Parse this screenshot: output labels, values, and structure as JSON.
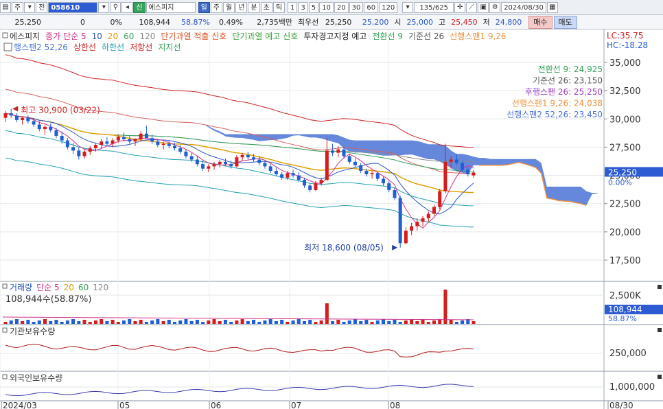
{
  "toolbar": {
    "code": "058610",
    "main_sub": "주",
    "all_label": "전",
    "credit_badge": "신",
    "stock_name": "에스피지",
    "periods": [
      "일",
      "주",
      "월",
      "년",
      "분",
      "초",
      "틱"
    ],
    "selected_period": "일",
    "intervals": [
      "1",
      "3",
      "5",
      "10",
      "20",
      "30",
      "60",
      "120"
    ],
    "count": "135/625",
    "date": "2024/08/30"
  },
  "quote": {
    "price": "25,250",
    "change": "0",
    "change_pct": "0%",
    "volume": "108,944",
    "vol_ratio": "58.87%",
    "turnover_pct": "0.49%",
    "amount": "2,735백만",
    "best_ask_label": "최우선",
    "best_ask": "25,250",
    "best_bid": "25,200",
    "open_label": "시",
    "open": "25,000",
    "high_label": "고",
    "high": "25,450",
    "low_label": "저",
    "low": "24,800",
    "buy_label": "매수",
    "sell_label": "매도"
  },
  "legend": {
    "line1": [
      {
        "text": "에스피지",
        "color": "#333333"
      },
      {
        "text": "종가 단순 5",
        "color": "#d0308a"
      },
      {
        "text": "10",
        "color": "#2a57c6"
      },
      {
        "text": "20",
        "color": "#e0a000"
      },
      {
        "text": "60",
        "color": "#35a35b"
      },
      {
        "text": "120",
        "color": "#8a8a8a"
      },
      {
        "text": "단기과열 적출 신호",
        "color": "#e05020"
      },
      {
        "text": "단기과열 예고 신호",
        "color": "#35a335"
      },
      {
        "text": "투자경고지정 예고",
        "color": "#222222"
      },
      {
        "text": "전환선 9",
        "color": "#35a35b"
      },
      {
        "text": "기준선 26",
        "color": "#555555"
      },
      {
        "text": "선행스팬1 9,26",
        "color": "#f09040"
      }
    ],
    "line2": [
      {
        "text": "행스팬2 52,26",
        "color": "#4b73d6"
      },
      {
        "text": "상한선",
        "color": "#d02020"
      },
      {
        "text": "하한선",
        "color": "#20a0b0"
      },
      {
        "text": "저항선",
        "color": "#d02020"
      },
      {
        "text": "지지선",
        "color": "#35a35b"
      }
    ],
    "lc": "LC:35.75",
    "hc": "HC:-18.28"
  },
  "ichimoku_labels": [
    {
      "text": "전환선 9: 24,925",
      "color": "#35a35b"
    },
    {
      "text": "기준선 26: 23,150",
      "color": "#555555"
    },
    {
      "text": "후행스팬 26: 25,250",
      "color": "#a040c0"
    },
    {
      "text": "선행스팬1 9,26: 24,038",
      "color": "#f09040"
    },
    {
      "text": "선행스팬2 52,26: 23,450",
      "color": "#4b73d6"
    }
  ],
  "annotations": {
    "high": "최고 30,900 (03/22)",
    "low": "최저 18,600 (08/05)"
  },
  "price_axis": [
    "35,000",
    "32,500",
    "30,000",
    "27,500",
    "25,000",
    "22,500",
    "20,000",
    "17,500"
  ],
  "price_tag": {
    "value": "25,250",
    "pct": "0.00%"
  },
  "volume_panel": {
    "legend": [
      {
        "text": "거래량",
        "color": "#2a57c6"
      },
      {
        "text": "단순 5",
        "color": "#d0308a"
      },
      {
        "text": "20",
        "color": "#e0a000"
      },
      {
        "text": "60",
        "color": "#35a35b"
      },
      {
        "text": "120",
        "color": "#8a8a8a"
      }
    ],
    "current": "108,944주(58.87%)",
    "axis": "2,500K",
    "tag_value": "108,944",
    "tag_pct": "58.87%"
  },
  "inst_panel": {
    "title": "기관보유수량",
    "axis": "250,000"
  },
  "foreign_panel": {
    "title": "외국인보유수량",
    "axis": "1,000,000"
  },
  "x_axis": [
    "2024/03",
    "05",
    "06",
    "07",
    "08",
    "08/30"
  ],
  "chart_data": {
    "type": "candlestick",
    "ylim": [
      16500,
      36000
    ],
    "x_labels": [
      "2024/03",
      "05",
      "06",
      "07",
      "08",
      "08/30"
    ],
    "candles": [
      [
        30100,
        30700,
        29700,
        30500
      ],
      [
        30500,
        30900,
        30100,
        30300
      ],
      [
        30300,
        30500,
        29700,
        29900
      ],
      [
        29900,
        30200,
        29500,
        30100
      ],
      [
        30100,
        30300,
        29600,
        29800
      ],
      [
        29800,
        30100,
        29300,
        29500
      ],
      [
        29500,
        29800,
        28900,
        29100
      ],
      [
        29100,
        29500,
        28600,
        29300
      ],
      [
        29300,
        29600,
        28800,
        29000
      ],
      [
        29000,
        29200,
        28300,
        28500
      ],
      [
        28500,
        28900,
        27800,
        28100
      ],
      [
        28100,
        28300,
        27300,
        27500
      ],
      [
        27500,
        27900,
        26900,
        27200
      ],
      [
        27200,
        27500,
        26400,
        26700
      ],
      [
        26700,
        27300,
        26500,
        27100
      ],
      [
        27100,
        27600,
        26800,
        27400
      ],
      [
        27400,
        27900,
        27100,
        27700
      ],
      [
        27700,
        28200,
        27400,
        28000
      ],
      [
        28000,
        28400,
        27600,
        27800
      ],
      [
        27800,
        28300,
        27500,
        28100
      ],
      [
        28100,
        28600,
        27900,
        28400
      ],
      [
        28400,
        28800,
        28000,
        28200
      ],
      [
        28200,
        28500,
        27800,
        28000
      ],
      [
        28000,
        28300,
        27600,
        28200
      ],
      [
        28200,
        28900,
        28000,
        28700
      ],
      [
        28700,
        29400,
        28500,
        28300
      ],
      [
        28300,
        28600,
        27800,
        28000
      ],
      [
        28000,
        28200,
        27500,
        27700
      ],
      [
        27700,
        28000,
        27300,
        27800
      ],
      [
        27800,
        28100,
        27400,
        27600
      ],
      [
        27600,
        27900,
        27200,
        27400
      ],
      [
        27400,
        27700,
        26900,
        27100
      ],
      [
        27100,
        27300,
        26500,
        26700
      ],
      [
        26700,
        27000,
        26200,
        26400
      ],
      [
        26400,
        26700,
        25800,
        26000
      ],
      [
        26000,
        26300,
        25400,
        25600
      ],
      [
        25600,
        26000,
        25300,
        25800
      ],
      [
        25800,
        26200,
        25500,
        26000
      ],
      [
        26000,
        26400,
        25700,
        26200
      ],
      [
        26200,
        26500,
        25800,
        26000
      ],
      [
        26000,
        26300,
        25600,
        25800
      ],
      [
        25800,
        26800,
        25700,
        26600
      ],
      [
        26600,
        27000,
        26300,
        26800
      ],
      [
        26800,
        27100,
        26400,
        26600
      ],
      [
        26600,
        26900,
        26200,
        26400
      ],
      [
        26400,
        26700,
        25900,
        26100
      ],
      [
        26100,
        26300,
        25600,
        25800
      ],
      [
        25800,
        26000,
        25200,
        25400
      ],
      [
        25400,
        25700,
        24900,
        25100
      ],
      [
        25100,
        25300,
        24600,
        24800
      ],
      [
        24800,
        25400,
        24600,
        25200
      ],
      [
        25200,
        25500,
        24800,
        25000
      ],
      [
        25000,
        25300,
        24400,
        24600
      ],
      [
        24600,
        24800,
        23900,
        24100
      ],
      [
        24100,
        24300,
        23500,
        23700
      ],
      [
        23700,
        24500,
        23600,
        24300
      ],
      [
        24300,
        24800,
        24100,
        24600
      ],
      [
        24600,
        28300,
        24500,
        27200
      ],
      [
        27200,
        27800,
        26700,
        27000
      ],
      [
        27000,
        27600,
        26600,
        27300
      ],
      [
        27300,
        27500,
        26500,
        26700
      ],
      [
        26700,
        26900,
        26000,
        26200
      ],
      [
        26200,
        26500,
        25700,
        25900
      ],
      [
        25900,
        26100,
        25200,
        25400
      ],
      [
        25400,
        25600,
        24900,
        25100
      ],
      [
        25100,
        25400,
        24700,
        25200
      ],
      [
        25200,
        25300,
        24500,
        24700
      ],
      [
        24700,
        24900,
        24100,
        24300
      ],
      [
        24300,
        24500,
        23500,
        23700
      ],
      [
        23700,
        23900,
        22800,
        23000
      ],
      [
        23000,
        23200,
        18600,
        19000
      ],
      [
        19000,
        20400,
        18900,
        20100
      ],
      [
        20100,
        20800,
        19700,
        20500
      ],
      [
        20500,
        21200,
        20100,
        20900
      ],
      [
        20900,
        21400,
        20500,
        21200
      ],
      [
        21200,
        21800,
        20900,
        21600
      ],
      [
        21600,
        22400,
        21400,
        22200
      ],
      [
        22200,
        23800,
        22000,
        23600
      ],
      [
        23600,
        27800,
        23400,
        26200
      ],
      [
        26200,
        26700,
        25600,
        26400
      ],
      [
        26400,
        26900,
        25900,
        26100
      ],
      [
        26100,
        26300,
        25300,
        25500
      ],
      [
        25500,
        25700,
        24900,
        25100
      ],
      [
        25000,
        25450,
        24800,
        25250
      ]
    ]
  }
}
